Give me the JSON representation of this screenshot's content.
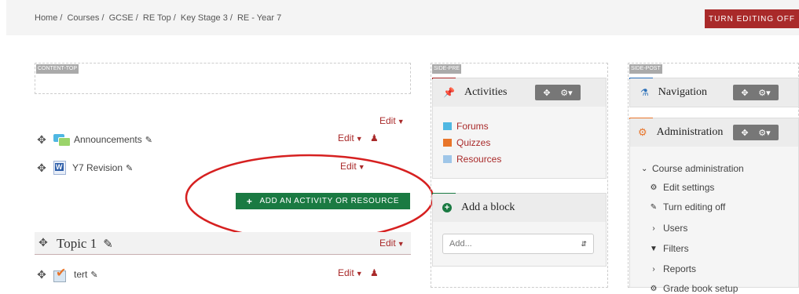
{
  "breadcrumb": [
    "Home",
    "Courses",
    "GCSE",
    "RE Top",
    "Key Stage 3",
    "RE - Year 7"
  ],
  "editing_button": "TURN EDITING OFF",
  "regions": {
    "content_top": "CONTENT-TOP",
    "side_pre": "SIDE-PRE",
    "side_post": "SIDE-POST"
  },
  "main": {
    "section_edit": "Edit",
    "activities": [
      {
        "name": "Announcements",
        "edit": "Edit",
        "icon": "forum-icon"
      },
      {
        "name": "Y7 Revision",
        "edit": "Edit",
        "icon": "word-doc-icon"
      }
    ],
    "add_activity": "ADD AN ACTIVITY OR RESOURCE",
    "topic": {
      "title": "Topic 1",
      "edit": "Edit"
    },
    "topic_activities": [
      {
        "name": "tert",
        "edit": "Edit",
        "icon": "quiz-icon"
      }
    ]
  },
  "side_pre": {
    "activities_block": {
      "title": "Activities",
      "items": [
        "Forums",
        "Quizzes",
        "Resources"
      ]
    },
    "add_block": {
      "title": "Add a block",
      "select_value": "Add..."
    }
  },
  "side_post": {
    "navigation_block": {
      "title": "Navigation"
    },
    "administration_block": {
      "title": "Administration",
      "items": [
        "Course administration",
        "Edit settings",
        "Turn editing off",
        "Users",
        "Filters",
        "Reports",
        "Grade book setup"
      ]
    }
  },
  "colors": {
    "brand_red": "#a92a2a",
    "add_green": "#1a7a42",
    "accent_blue": "#2a6fb8",
    "accent_orange": "#e8752a"
  }
}
